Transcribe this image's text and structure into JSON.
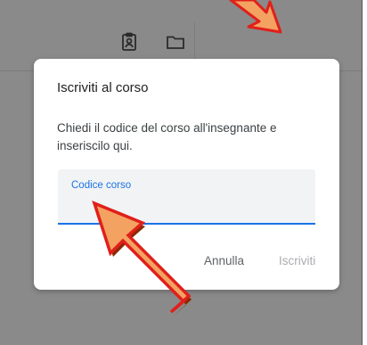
{
  "toolbar": {
    "icons": [
      "classroom-clipboard-icon",
      "folder-icon"
    ]
  },
  "dialog": {
    "title": "Iscriviti al corso",
    "description": "Chiedi il codice del corso all'insegnante e inseriscilo qui.",
    "field": {
      "label": "Codice corso",
      "value": ""
    },
    "cancel_label": "Annulla",
    "join_label": "Iscriviti"
  },
  "colors": {
    "accent": "#1a73e8",
    "arrow_fill": "#f4a261",
    "arrow_border": "#e0201b"
  }
}
